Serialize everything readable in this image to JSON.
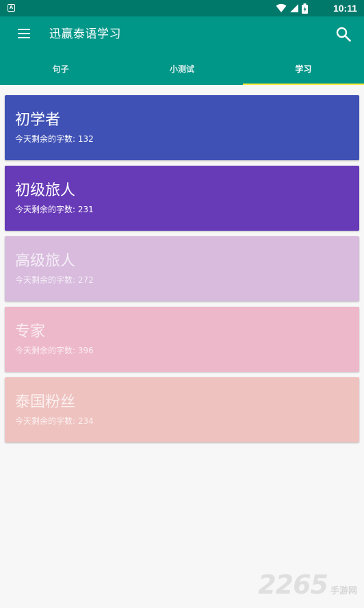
{
  "status_bar": {
    "time": "10:11",
    "icons": [
      "notification-a-icon",
      "wifi-icon",
      "signal-icon",
      "battery-icon"
    ]
  },
  "app_bar": {
    "title": "迅赢泰语学习"
  },
  "tabs": [
    {
      "label": "句子",
      "active": false
    },
    {
      "label": "小测试",
      "active": false
    },
    {
      "label": "学习",
      "active": true
    }
  ],
  "colors": {
    "status_bar": "#00796b",
    "app_bar": "#009688",
    "tab_indicator": "#ffeb3b"
  },
  "levels": [
    {
      "title": "初学者",
      "subtitle": "今天剩余的字数: 132",
      "color": "#3f51b5"
    },
    {
      "title": "初级旅人",
      "subtitle": "今天剩余的字数: 231",
      "color": "#673ab7"
    },
    {
      "title": "高级旅人",
      "subtitle": "今天剩余的字数: 272",
      "color": "#d8bbdd"
    },
    {
      "title": "专家",
      "subtitle": "今天剩余的字数: 396",
      "color": "#edb8c9"
    },
    {
      "title": "泰国粉丝",
      "subtitle": "今天剩余的字数: 234",
      "color": "#eec2bf"
    }
  ],
  "watermark": {
    "number": "2265",
    "text": "手游网"
  }
}
